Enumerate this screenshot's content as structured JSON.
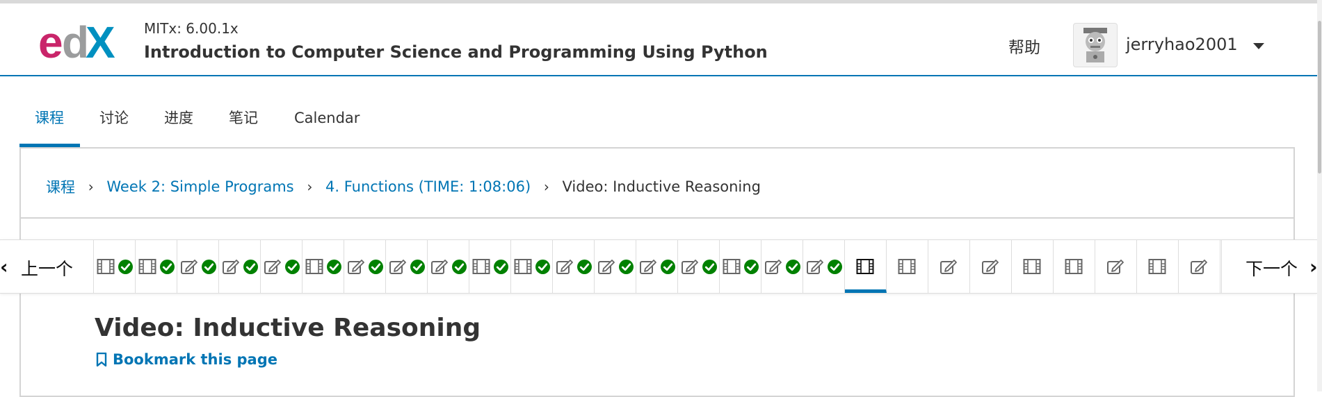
{
  "header": {
    "logo_text": "edX",
    "course_org": "MITx: 6.00.1x",
    "course_title": "Introduction to Computer Science and Programming Using Python",
    "help_label": "帮助",
    "username": "jerryhao2001"
  },
  "tabs": [
    {
      "label": "课程",
      "active": true
    },
    {
      "label": "讨论",
      "active": false
    },
    {
      "label": "进度",
      "active": false
    },
    {
      "label": "笔记",
      "active": false
    },
    {
      "label": "Calendar",
      "active": false
    }
  ],
  "breadcrumb": {
    "items": [
      "课程",
      "Week 2: Simple Programs",
      "4. Functions (TIME: 1:08:06)"
    ],
    "current": "Video: Inductive Reasoning"
  },
  "sequence": {
    "prev_label": "上一个",
    "next_label": "下一个",
    "units": [
      {
        "type": "video",
        "completed": true
      },
      {
        "type": "video",
        "completed": true
      },
      {
        "type": "problem",
        "completed": true
      },
      {
        "type": "problem",
        "completed": true
      },
      {
        "type": "problem",
        "completed": true
      },
      {
        "type": "video",
        "completed": true
      },
      {
        "type": "problem",
        "completed": true
      },
      {
        "type": "problem",
        "completed": true
      },
      {
        "type": "problem",
        "completed": true
      },
      {
        "type": "video",
        "completed": true
      },
      {
        "type": "video",
        "completed": true
      },
      {
        "type": "problem",
        "completed": true
      },
      {
        "type": "problem",
        "completed": true
      },
      {
        "type": "problem",
        "completed": true
      },
      {
        "type": "problem",
        "completed": true
      },
      {
        "type": "video",
        "completed": true
      },
      {
        "type": "problem",
        "completed": true
      },
      {
        "type": "problem",
        "completed": true
      },
      {
        "type": "video",
        "completed": false,
        "active": true
      },
      {
        "type": "video",
        "completed": false
      },
      {
        "type": "problem",
        "completed": false
      },
      {
        "type": "problem",
        "completed": false
      },
      {
        "type": "video",
        "completed": false
      },
      {
        "type": "video",
        "completed": false
      },
      {
        "type": "problem",
        "completed": false
      },
      {
        "type": "video",
        "completed": false
      },
      {
        "type": "problem",
        "completed": false
      }
    ]
  },
  "unit": {
    "title": "Video: Inductive Reasoning",
    "bookmark_label": "Bookmark this page"
  },
  "colors": {
    "accent": "#0075b4",
    "check": "#008100",
    "edx_magenta": "#c9256a",
    "edx_gray": "#8a8b8c",
    "edx_blue": "#0090c0"
  }
}
